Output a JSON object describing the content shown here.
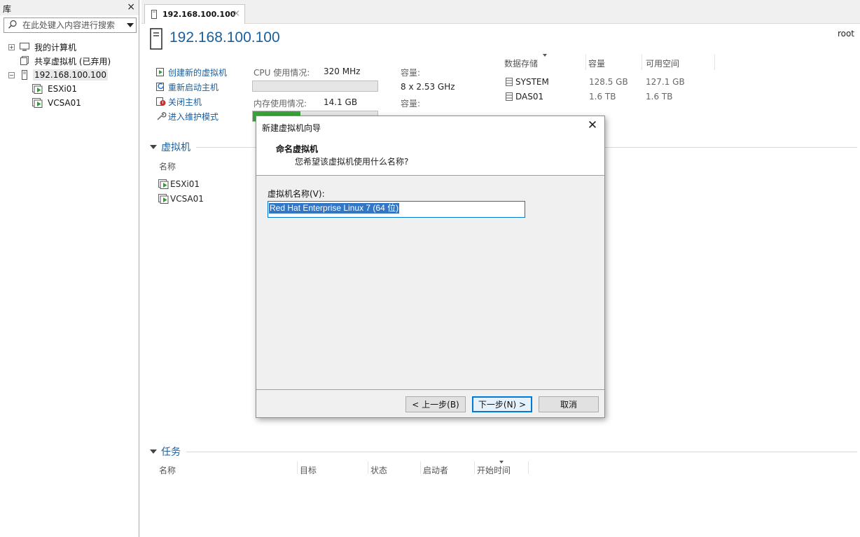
{
  "library": {
    "title": "库",
    "close": "×",
    "search_placeholder": "在此处键入内容进行搜索",
    "tree": [
      {
        "label": "我的计算机",
        "expander": "+"
      },
      {
        "label": "共享虚拟机 (已弃用)",
        "expander": ""
      },
      {
        "label": "192.168.100.100",
        "expander": "−"
      },
      {
        "label": "ESXi01",
        "expander": ""
      },
      {
        "label": "VCSA01",
        "expander": ""
      }
    ]
  },
  "tab": {
    "label": "192.168.100.100",
    "close": "×"
  },
  "host": {
    "title": "192.168.100.100",
    "user": "root"
  },
  "actions": [
    {
      "label": "创建新的虚拟机"
    },
    {
      "label": "重新启动主机"
    },
    {
      "label": "关闭主机"
    },
    {
      "label": "进入维护模式"
    }
  ],
  "resources": {
    "cpu_label": "CPU 使用情况:",
    "cpu_value": "320 MHz",
    "cpu_capacity_label": "容量:",
    "cpu_capacity_value": "8 x 2.53 GHz",
    "cpu_usage_fraction": 0.0,
    "mem_label": "内存使用情况:",
    "mem_value": "14.1 GB",
    "mem_capacity_label": "容量:",
    "mem_usage_fraction": 0.38
  },
  "datastores": {
    "headers": [
      "数据存储",
      "容量",
      "可用空间"
    ],
    "rows": [
      {
        "name": "SYSTEM",
        "capacity": "128.5 GB",
        "free": "127.1 GB"
      },
      {
        "name": "DAS01",
        "capacity": "1.6 TB",
        "free": "1.6 TB"
      }
    ]
  },
  "vm_section": {
    "title": "虚拟机",
    "column": "名称",
    "rows": [
      {
        "label": "ESXi01"
      },
      {
        "label": "VCSA01"
      }
    ]
  },
  "task_section": {
    "title": "任务",
    "columns": [
      "名称",
      "目标",
      "状态",
      "启动者",
      "开始时间"
    ]
  },
  "dialog": {
    "title": "新建虚拟机向导",
    "close": "✕",
    "step_title": "命名虚拟机",
    "step_desc": "您希望该虚拟机使用什么名称?",
    "field_label": "虚拟机名称(V):",
    "field_value": "Red Hat Enterprise Linux 7 (64 位)",
    "buttons": {
      "back": "< 上一步(B)",
      "next": "下一步(N) >",
      "cancel": "取消"
    },
    "accent": "#0078d7"
  }
}
